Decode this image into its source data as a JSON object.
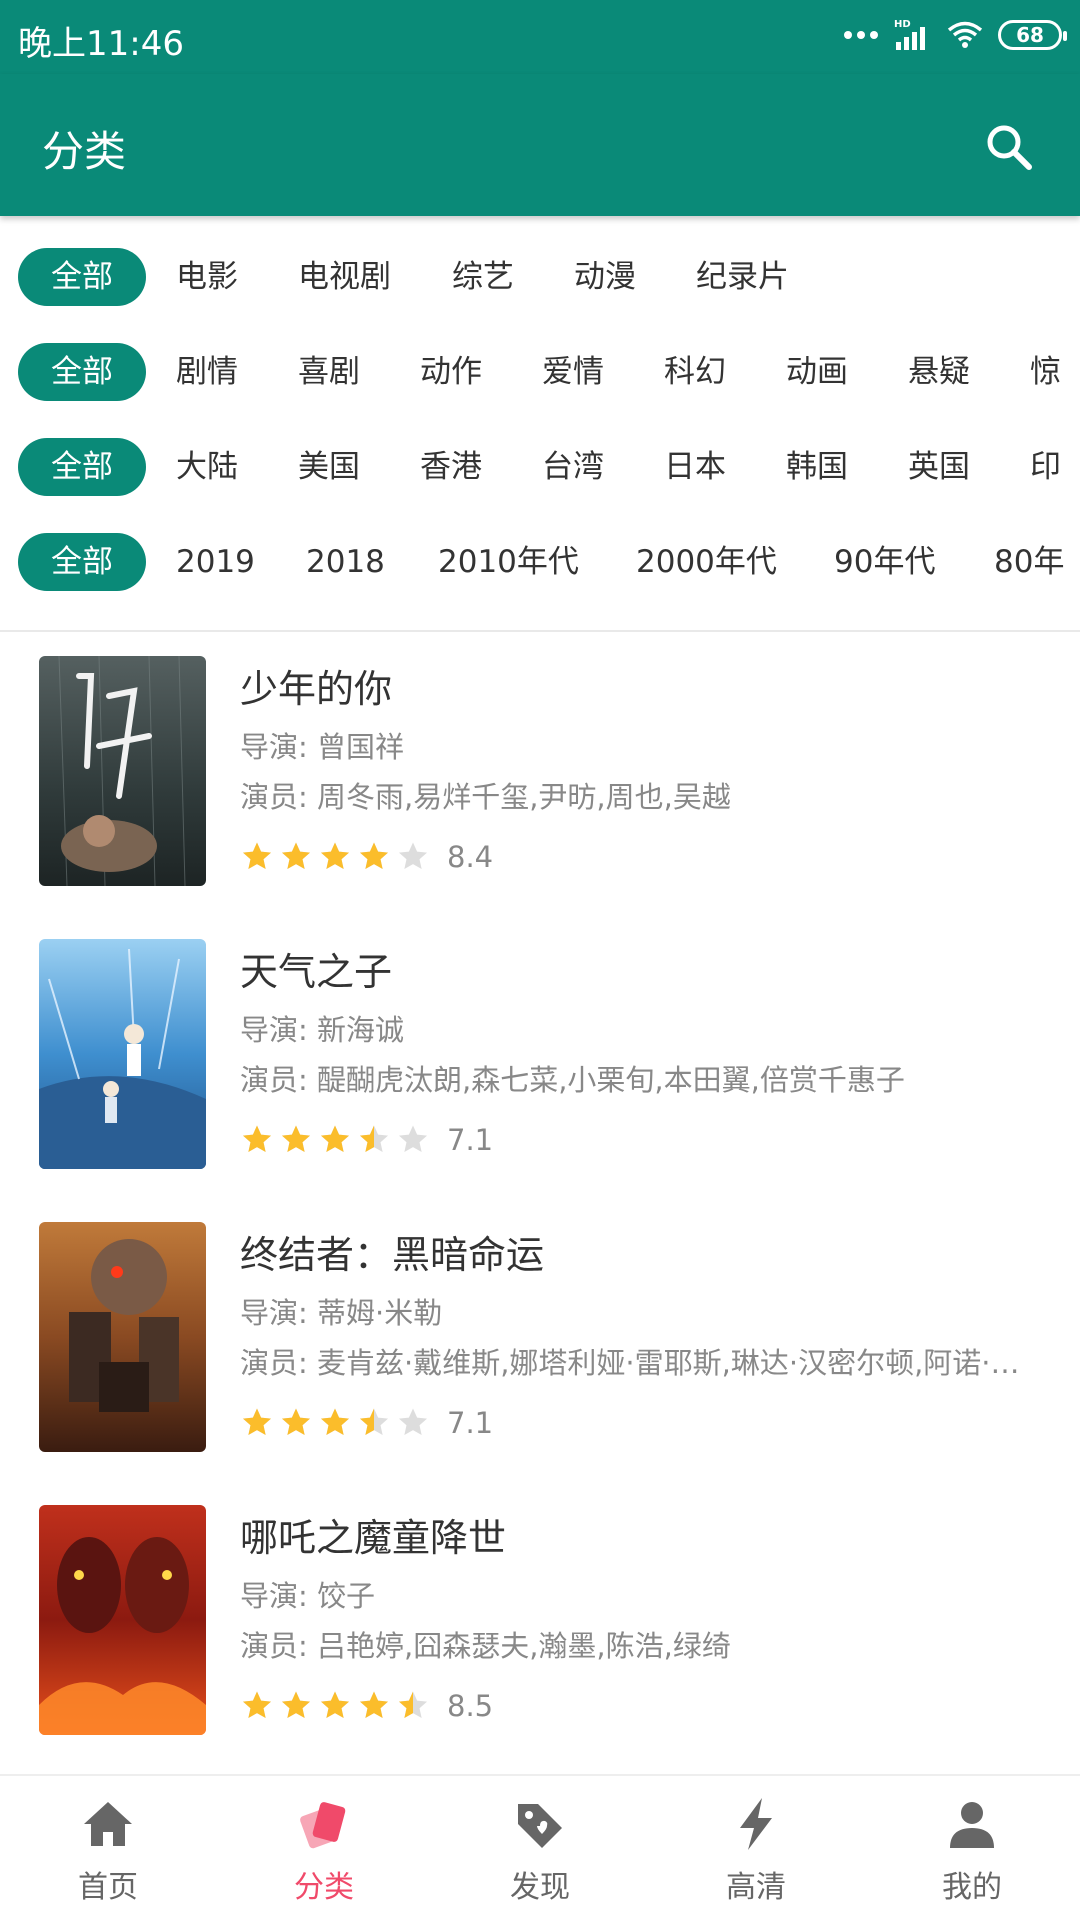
{
  "status_bar": {
    "time": "晚上11:46",
    "network": "HD",
    "battery": "68"
  },
  "toolbar": {
    "title": "分类"
  },
  "filters": {
    "types": [
      "全部",
      "电影",
      "电视剧",
      "综艺",
      "动漫",
      "纪录片"
    ],
    "genres": [
      "全部",
      "剧情",
      "喜剧",
      "动作",
      "爱情",
      "科幻",
      "动画",
      "悬疑",
      "惊"
    ],
    "regions": [
      "全部",
      "大陆",
      "美国",
      "香港",
      "台湾",
      "日本",
      "韩国",
      "英国",
      "印"
    ],
    "years": [
      "全部",
      "2019",
      "2018",
      "2010年代",
      "2000年代",
      "90年代",
      "80年"
    ]
  },
  "movies": [
    {
      "title": "少年的你",
      "director": "导演: 曾国祥",
      "actors": "演员: 周冬雨,易烊千玺,尹昉,周也,吴越",
      "rating": 8.4,
      "rating_text": "8.4"
    },
    {
      "title": "天气之子",
      "director": "导演: 新海诚",
      "actors": "演员: 醍醐虎汰朗,森七菜,小栗旬,本田翼,倍赏千惠子",
      "rating": 7.1,
      "rating_text": "7.1"
    },
    {
      "title": "终结者：黑暗命运",
      "director": "导演: 蒂姆·米勒",
      "actors": "演员: 麦肯兹·戴维斯,娜塔利娅·雷耶斯,琳达·汉密尔顿,阿诺·施瓦辛格",
      "rating": 7.1,
      "rating_text": "7.1"
    },
    {
      "title": "哪吒之魔童降世",
      "director": "导演: 饺子",
      "actors": "演员: 吕艳婷,囧森瑟夫,瀚墨,陈浩,绿绮",
      "rating": 8.5,
      "rating_text": "8.5"
    }
  ],
  "bottom_nav": [
    {
      "label": "首页",
      "icon": "home-icon",
      "active": false
    },
    {
      "label": "分类",
      "icon": "category-icon",
      "active": true
    },
    {
      "label": "发现",
      "icon": "discover-tag-icon",
      "active": false
    },
    {
      "label": "高清",
      "icon": "hd-lightning-icon",
      "active": false
    },
    {
      "label": "我的",
      "icon": "profile-icon",
      "active": false
    }
  ],
  "colors": {
    "primary": "#0a8a78",
    "accent": "#f04a6a",
    "star": "#fbbd2b",
    "star_empty": "#dddddd"
  }
}
